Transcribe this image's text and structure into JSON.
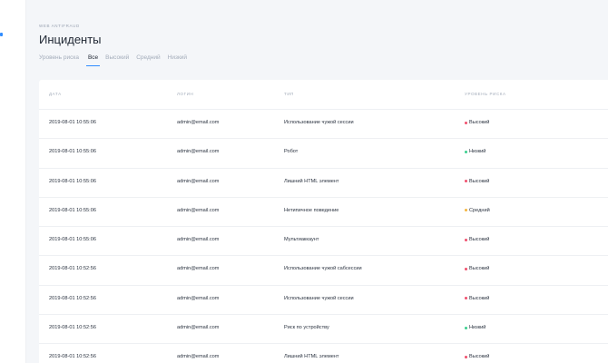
{
  "header": {
    "eyebrow": "Web antifraud",
    "title": "Инциденты"
  },
  "filters": {
    "label": "Уровень риска",
    "tabs": [
      {
        "label": "Все",
        "active": true
      },
      {
        "label": "Высокий",
        "active": false
      },
      {
        "label": "Средний",
        "active": false
      },
      {
        "label": "Низкий",
        "active": false
      }
    ]
  },
  "table": {
    "columns": [
      "Дата",
      "Логин",
      "Тип",
      "Уровень риска"
    ],
    "risk_colors": {
      "Высокий": "#f0506e",
      "Средний": "#f5b53f",
      "Низкий": "#3ccf8e"
    },
    "rows": [
      {
        "date": "2019-08-01 10:55:06",
        "login": "admin@email.com",
        "type": "Использование чужой сессии",
        "risk": "Высокий"
      },
      {
        "date": "2019-08-01 10:55:06",
        "login": "admin@email.com",
        "type": "Робот",
        "risk": "Низкий"
      },
      {
        "date": "2019-08-01 10:55:06",
        "login": "admin@email.com",
        "type": "Лишний HTML элемент",
        "risk": "Высокий"
      },
      {
        "date": "2019-08-01 10:55:06",
        "login": "admin@email.com",
        "type": "Нетипичное поведение",
        "risk": "Средний"
      },
      {
        "date": "2019-08-01 10:55:06",
        "login": "admin@email.com",
        "type": "Мультиаккаунт",
        "risk": "Высокий"
      },
      {
        "date": "2019-08-01 10:52:56",
        "login": "admin@email.com",
        "type": "Использование чужой сабсессии",
        "risk": "Высокий"
      },
      {
        "date": "2019-08-01 10:52:56",
        "login": "admin@email.com",
        "type": "Использование чужой сессии",
        "risk": "Высокий"
      },
      {
        "date": "2019-08-01 10:52:56",
        "login": "admin@email.com",
        "type": "Риск по устройству",
        "risk": "Низкий"
      },
      {
        "date": "2019-08-01 10:52:56",
        "login": "admin@email.com",
        "type": "Лишний HTML элемент",
        "risk": "Высокий"
      }
    ]
  }
}
